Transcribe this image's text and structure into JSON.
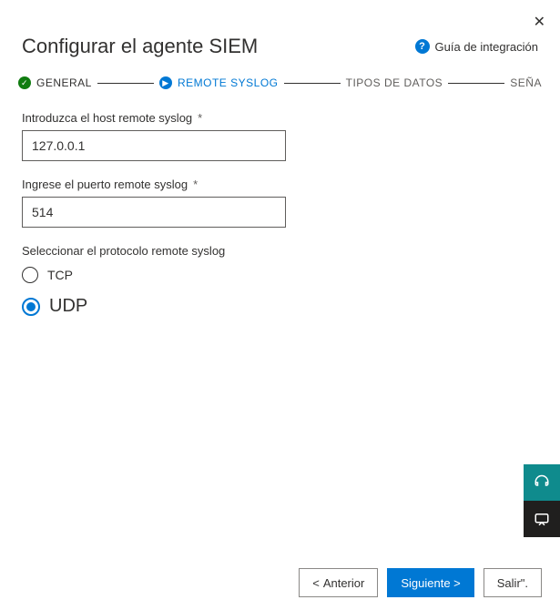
{
  "header": {
    "title": "Configurar el agente SIEM",
    "guide_label": "Guía de integración"
  },
  "stepper": {
    "steps": [
      {
        "label": "GENERAL",
        "state": "done"
      },
      {
        "label": "REMOTE SYSLOG",
        "state": "active"
      },
      {
        "label": "TIPOS DE DATOS",
        "state": "pending"
      },
      {
        "label": "SEÑA",
        "state": "pending"
      }
    ]
  },
  "form": {
    "host_label": "Introduzca el host remote syslog",
    "host_value": "127.0.0.1",
    "port_label": "Ingrese el puerto remote syslog",
    "port_value": "514",
    "protocol_label": "Seleccionar el protocolo remote syslog",
    "protocol_options": {
      "tcp": "TCP",
      "udp": "UDP"
    },
    "protocol_selected": "udp"
  },
  "footer": {
    "prev": "Anterior",
    "next": "Siguiente >",
    "exit": "Salir\"."
  }
}
